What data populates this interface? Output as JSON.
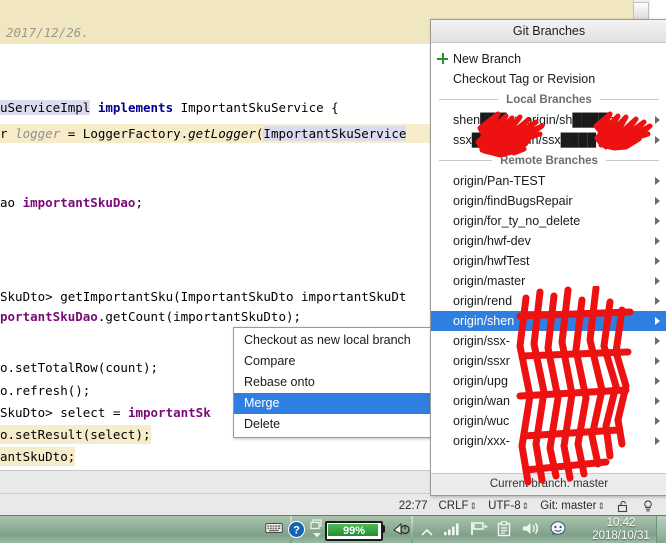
{
  "editor": {
    "doc_comment": "2017/12/26.",
    "lines": [
      "uServiceImpl implements ImportantSkuService {",
      "r logger = LoggerFactory.getLogger(ImportantSkuService",
      "ao importantSkuDao;",
      "SkuDto> getImportantSku(ImportantSkuDto importantSkuDt",
      "portantSkuDao.getCount(importantSkuDto);",
      "o.setTotalRow(count);",
      "o.refresh();",
      "SkuDto> select = importantSk",
      "o.setResult(select);",
      "antSkuDto;"
    ]
  },
  "status_bar": {
    "caret_position": "22:77",
    "line_separator": "CRLF",
    "encoding": "UTF-8",
    "vcs_branch": "Git: master",
    "lock_icon": "unlocked-icon",
    "inspection_icon": "inspections-icon"
  },
  "git_popup": {
    "title": "Git Branches",
    "actions": [
      {
        "label": "New Branch",
        "icon": "plus-icon"
      },
      {
        "label": "Checkout Tag or Revision",
        "icon": ""
      }
    ],
    "local_header": "Local Branches",
    "local_branches": [
      {
        "label": "shen███ -> origin/sh████n",
        "redacted": true
      },
      {
        "label": "ssx██ -> origin/ssx████",
        "redacted": true
      }
    ],
    "remote_header": "Remote Branches",
    "remote_branches": [
      {
        "label": "origin/Pan-TEST",
        "selected": false
      },
      {
        "label": "origin/findBugsRepair",
        "selected": false
      },
      {
        "label": "origin/for_ty_no_delete",
        "selected": false
      },
      {
        "label": "origin/hwf-dev",
        "selected": false
      },
      {
        "label": "origin/hwfTest",
        "selected": false
      },
      {
        "label": "origin/master",
        "selected": false
      },
      {
        "label": "origin/rend",
        "selected": false
      },
      {
        "label": "origin/shen",
        "selected": true
      },
      {
        "label": "origin/ssx-",
        "selected": false
      },
      {
        "label": "origin/ssxr",
        "selected": false
      },
      {
        "label": "origin/upg",
        "selected": false
      },
      {
        "label": "origin/wan",
        "selected": false
      },
      {
        "label": "origin/wuc",
        "selected": false
      },
      {
        "label": "origin/xxx-",
        "selected": false
      }
    ],
    "footer": "Current branch: master"
  },
  "context_menu": {
    "items": [
      {
        "label": "Checkout as new local branch",
        "selected": false
      },
      {
        "label": "Compare",
        "selected": false
      },
      {
        "label": "Rebase onto",
        "selected": false
      },
      {
        "label": "Merge",
        "selected": true
      },
      {
        "label": "Delete",
        "selected": false
      }
    ]
  },
  "taskbar": {
    "battery_percent": "99%",
    "clock_time": "10:42",
    "clock_date": "2018/10/31",
    "icons": [
      "keyboard-icon",
      "help-icon",
      "windows-restore-icon",
      "battery-icon",
      "mouse-icon",
      "show-hidden-icons-icon",
      "network-signal-icon",
      "flag-action-center-icon",
      "clipboard-icon",
      "volume-icon",
      "messenger-icon"
    ]
  },
  "colors": {
    "selection_blue": "#2f7fe0",
    "doc_comment_band": "#f0e7c0",
    "taskbar_green": "#8fae96",
    "redaction_red": "#ee1111",
    "keyword_blue": "#00008f",
    "field_purple": "#7a0a7a"
  }
}
